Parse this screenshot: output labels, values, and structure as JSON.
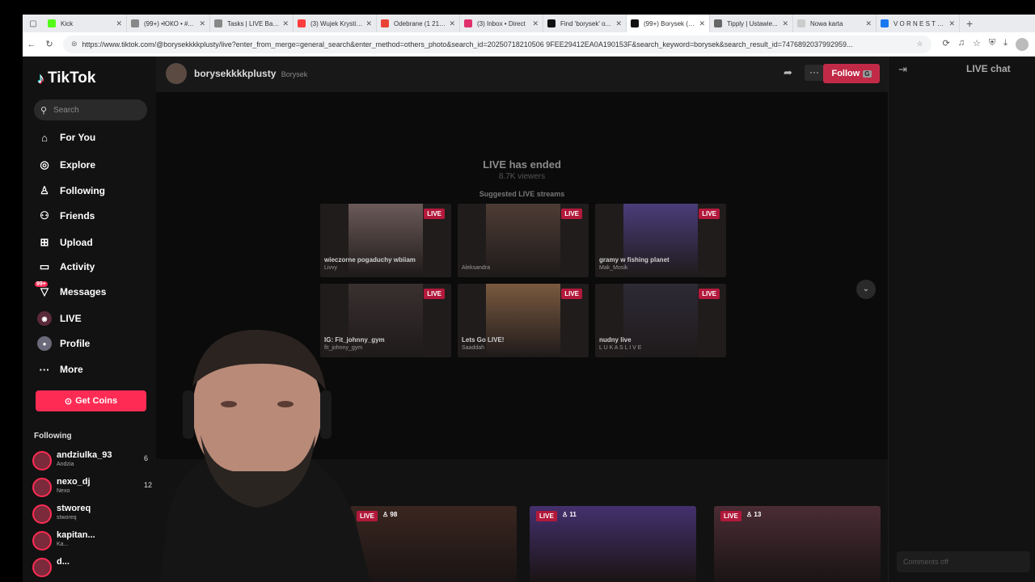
{
  "browser": {
    "tabs": [
      {
        "title": "Kick",
        "color": "#53fc18"
      },
      {
        "title": "(99+) •ЮКО • #...",
        "color": "#888888"
      },
      {
        "title": "Tasks | LIVE Back...",
        "color": "#888888"
      },
      {
        "title": "(3) Wujek Krystia...",
        "color": "#ff3d3d"
      },
      {
        "title": "Odebrane (1 215...",
        "color": "#ea4335"
      },
      {
        "title": "(3) Inbox • Direct",
        "color": "#e1306c"
      },
      {
        "title": "Find 'borysek' o...",
        "color": "#111111"
      },
      {
        "title": "(99+) Borysek (@...",
        "color": "#111111"
      },
      {
        "title": "Tipply | Ustawie...",
        "color": "#666666"
      },
      {
        "title": "Nowa karta",
        "color": "#cccccc"
      },
      {
        "title": "V O R N E S T (@...",
        "color": "#1877f2"
      }
    ],
    "url": "https://www.tiktok.com/@borysekkkkplusty/live?enter_from_merge=general_search&enter_method=others_photo&search_id=20250718210506 9FEE29412EA0A190153F&search_keyword=borysek&search_result_id=7476892037992959..."
  },
  "sidebar": {
    "logo": "TikTok",
    "search_placeholder": "Search",
    "nav": [
      {
        "label": "For You",
        "icon": "home-icon"
      },
      {
        "label": "Explore",
        "icon": "compass-icon"
      },
      {
        "label": "Following",
        "icon": "following-icon"
      },
      {
        "label": "Friends",
        "icon": "friends-icon"
      },
      {
        "label": "Upload",
        "icon": "upload-icon"
      },
      {
        "label": "Activity",
        "icon": "activity-icon"
      },
      {
        "label": "Messages",
        "icon": "messages-icon",
        "badge": "99+"
      },
      {
        "label": "LIVE",
        "icon": "live-icon"
      },
      {
        "label": "Profile",
        "icon": "profile-icon"
      },
      {
        "label": "More",
        "icon": "more-icon"
      }
    ],
    "coins_button": "Get Coins",
    "following_heading": "Following",
    "following": [
      {
        "name": "andziulka_93",
        "sub": "Andzia",
        "count": "6"
      },
      {
        "name": "nexo_dj",
        "sub": "Nexo",
        "count": "12"
      },
      {
        "name": "stworeq",
        "sub": "stworeq",
        "count": ""
      },
      {
        "name": "kapitan...",
        "sub": "Ka...",
        "count": ""
      },
      {
        "name": "d...",
        "sub": "",
        "count": ""
      }
    ]
  },
  "live": {
    "host_name": "borysekkkkplusty",
    "host_nick": "Borysek",
    "follow_label": "Follow",
    "follow_key": "G",
    "more_label": "···",
    "ended_title": "LIVE has ended",
    "ended_viewers": "8.7K viewers",
    "suggested_heading": "Suggested LIVE streams",
    "cards": [
      {
        "title": "wieczorne pogaduchy wbiiam",
        "user": "Livvy",
        "tag": "LIVE",
        "tone": "#6b5a58"
      },
      {
        "title": "",
        "user": "Aleksandra",
        "tag": "LIVE",
        "tone": "#4d3c34"
      },
      {
        "title": "gramy w fishing planet",
        "user": "Mak_Mosik",
        "tag": "LIVE",
        "tone": "#4a3d7a"
      },
      {
        "title": "IG: Fit_johnny_gym",
        "user": "fit_johnny_gym",
        "tag": "LIVE",
        "tone": "#3a3030"
      },
      {
        "title": "Lets Go LIVE!",
        "user": "Saaddah",
        "tag": "LIVE",
        "tone": "#7a5a40"
      },
      {
        "title": "nudny live",
        "user": "L U K A S L I V E",
        "tag": "LIVE",
        "tone": "#2e2a36"
      }
    ],
    "bottom_cards": [
      {
        "tag": "LIVE",
        "viewers": "98",
        "tone": "#3a2620"
      },
      {
        "tag": "LIVE",
        "viewers": "11",
        "tone": "#44306e"
      },
      {
        "tag": "LIVE",
        "viewers": "13",
        "tone": "#4a2c34"
      }
    ]
  },
  "chat": {
    "title": "LIVE chat",
    "comments_off": "Comments off"
  }
}
